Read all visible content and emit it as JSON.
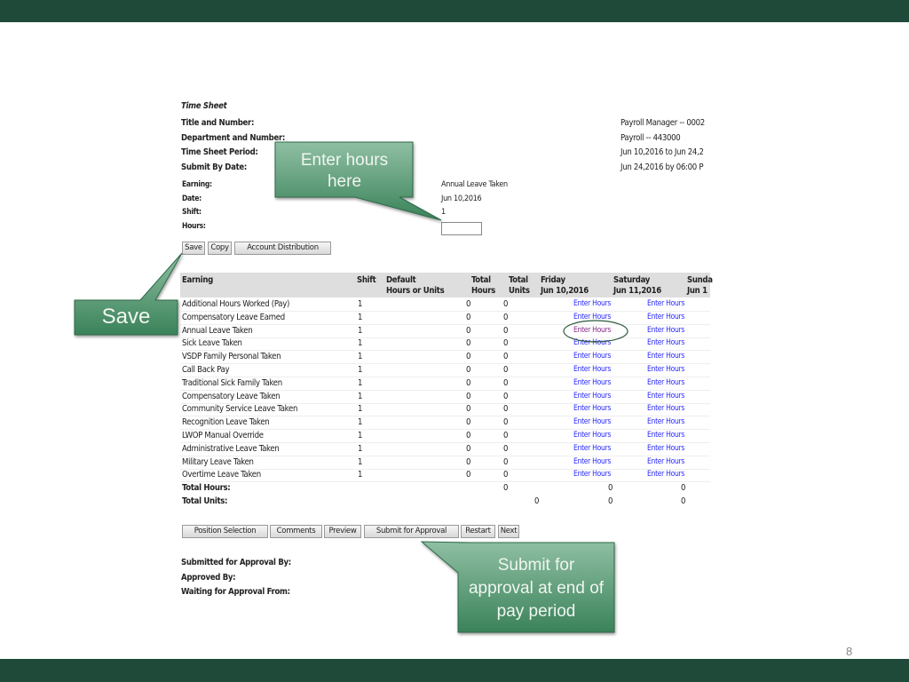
{
  "form": {
    "heading": "Time Sheet",
    "fields": [
      {
        "label": "Title and Number:",
        "value": "Payroll Manager -- 0002"
      },
      {
        "label": "Department and Number:",
        "value": "Payroll -- 443000"
      },
      {
        "label": "Time Sheet Period:",
        "value": "Jun 10,2016 to Jun 24,2"
      },
      {
        "label": "Submit By Date:",
        "value": "Jun 24,2016 by 06:00 P"
      }
    ],
    "entry": [
      {
        "label": "Earning:",
        "value": "Annual Leave Taken"
      },
      {
        "label": "Date:",
        "value": "Jun 10,2016"
      },
      {
        "label": "Shift:",
        "value": "1"
      },
      {
        "label": "Hours:",
        "value": ""
      }
    ],
    "buttons": {
      "save": "Save",
      "copy": "Copy",
      "account": "Account Distribution"
    }
  },
  "table": {
    "headers": {
      "earning": "Earning",
      "shift": "Shift",
      "default1": "Default",
      "default2": "Hours or Units",
      "th1": "Total",
      "th2": "Hours",
      "tu1": "Total",
      "tu2": "Units",
      "fri1": "Friday",
      "fri2": "Jun 10,2016",
      "sat1": "Saturday",
      "sat2": "Jun 11,2016",
      "sun1": "Sunda",
      "sun2": "Jun 1"
    },
    "link_label": "Enter Hours",
    "rows": [
      {
        "earning": "Additional Hours Worked (Pay)",
        "shift": "1",
        "total_hours": "0",
        "total_units": "0"
      },
      {
        "earning": "Compensatory Leave Earned",
        "shift": "1",
        "total_hours": "0",
        "total_units": "0"
      },
      {
        "earning": "Annual Leave Taken",
        "shift": "1",
        "total_hours": "0",
        "total_units": "0"
      },
      {
        "earning": "Sick Leave Taken",
        "shift": "1",
        "total_hours": "0",
        "total_units": "0"
      },
      {
        "earning": "VSDP Family Personal Taken",
        "shift": "1",
        "total_hours": "0",
        "total_units": "0"
      },
      {
        "earning": "Call Back Pay",
        "shift": "1",
        "total_hours": "0",
        "total_units": "0"
      },
      {
        "earning": "Traditional Sick Family Taken",
        "shift": "1",
        "total_hours": "0",
        "total_units": "0"
      },
      {
        "earning": "Compensatory Leave Taken",
        "shift": "1",
        "total_hours": "0",
        "total_units": "0"
      },
      {
        "earning": "Community Service Leave Taken",
        "shift": "1",
        "total_hours": "0",
        "total_units": "0"
      },
      {
        "earning": "Recognition Leave Taken",
        "shift": "1",
        "total_hours": "0",
        "total_units": "0"
      },
      {
        "earning": "LWOP Manual Override",
        "shift": "1",
        "total_hours": "0",
        "total_units": "0"
      },
      {
        "earning": "Administrative Leave Taken",
        "shift": "1",
        "total_hours": "0",
        "total_units": "0"
      },
      {
        "earning": "Military Leave Taken",
        "shift": "1",
        "total_hours": "0",
        "total_units": "0"
      },
      {
        "earning": "Overtime Leave Taken",
        "shift": "1",
        "total_hours": "0",
        "total_units": "0"
      }
    ],
    "total_hours": {
      "label": "Total Hours:",
      "a": "0",
      "fri": "0",
      "sat": "0"
    },
    "total_units": {
      "label": "Total Units:",
      "a": "0",
      "fri": "0",
      "sat": "0"
    }
  },
  "nav_buttons": [
    "Position Selection",
    "Comments",
    "Preview",
    "Submit for Approval",
    "Restart",
    "Next"
  ],
  "approval": [
    "Submitted for Approval By:",
    "Approved By:",
    "Waiting for Approval From:"
  ],
  "callouts": {
    "enter": "Enter hours here",
    "save": "Save",
    "submit": "Submit for approval at end of pay period"
  },
  "page_number": "8",
  "colors": {
    "bar": "#1f4a3a",
    "callout": "#3f8a62",
    "link": "#2a2aff",
    "visited": "#8a2a8a"
  }
}
